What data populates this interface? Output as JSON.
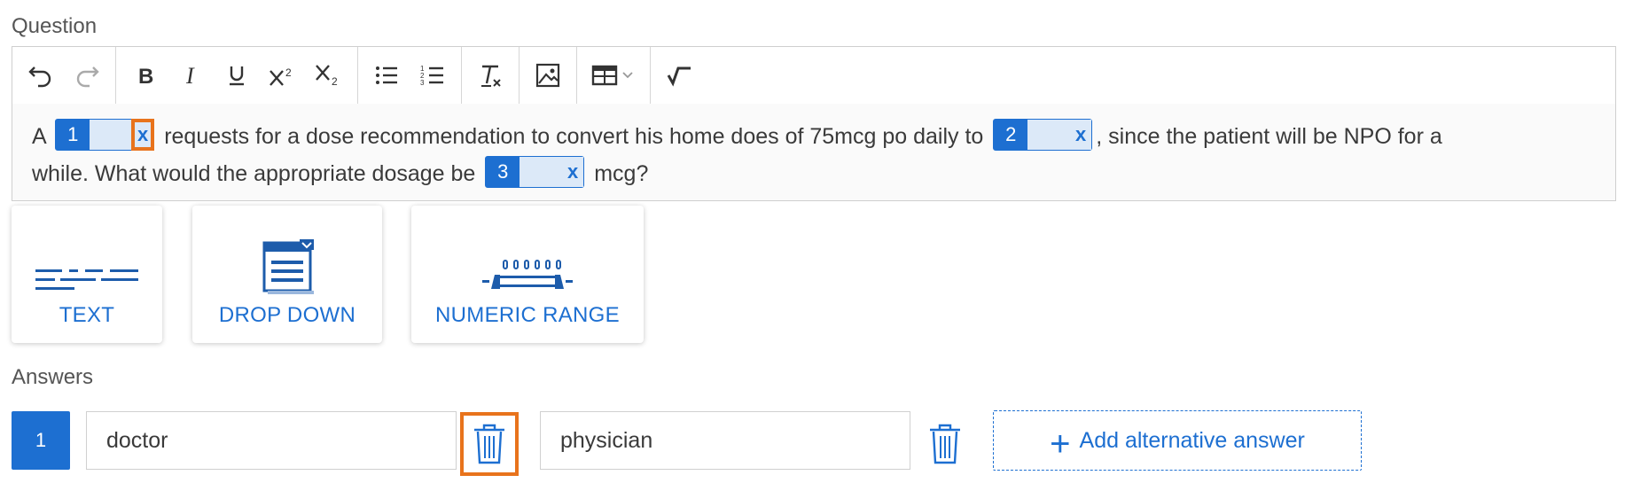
{
  "question_label": "Question",
  "answers_label": "Answers",
  "toolbar": {
    "groups": [
      [
        "undo-icon",
        "redo-icon"
      ],
      [
        "bold-icon",
        "italic-icon",
        "underline-icon",
        "superscript-icon",
        "subscript-icon"
      ],
      [
        "bullet-list-icon",
        "numbered-list-icon"
      ],
      [
        "clear-format-icon"
      ],
      [
        "image-icon"
      ],
      [
        "table-icon"
      ],
      [
        "square-root-icon"
      ]
    ]
  },
  "editor": {
    "seg1": "A",
    "blank1": "1",
    "seg2": "requests for a dose recommendation to convert his home does of 75mcg po daily to",
    "blank2": "2",
    "seg3": ", since the patient will be NPO for a",
    "seg4": "while. What would the appropriate dosage be",
    "blank3": "3",
    "seg5": "mcg?",
    "remove": "x"
  },
  "types": {
    "text": "TEXT",
    "dropdown": "DROP DOWN",
    "numeric": "NUMERIC RANGE"
  },
  "answer": {
    "number": "1",
    "primary": "doctor",
    "alternative": "physician",
    "add_label": "Add alternative answer",
    "add_icon": "+"
  },
  "colors": {
    "accent": "#1d6fd1",
    "highlight": "#e8731c"
  }
}
